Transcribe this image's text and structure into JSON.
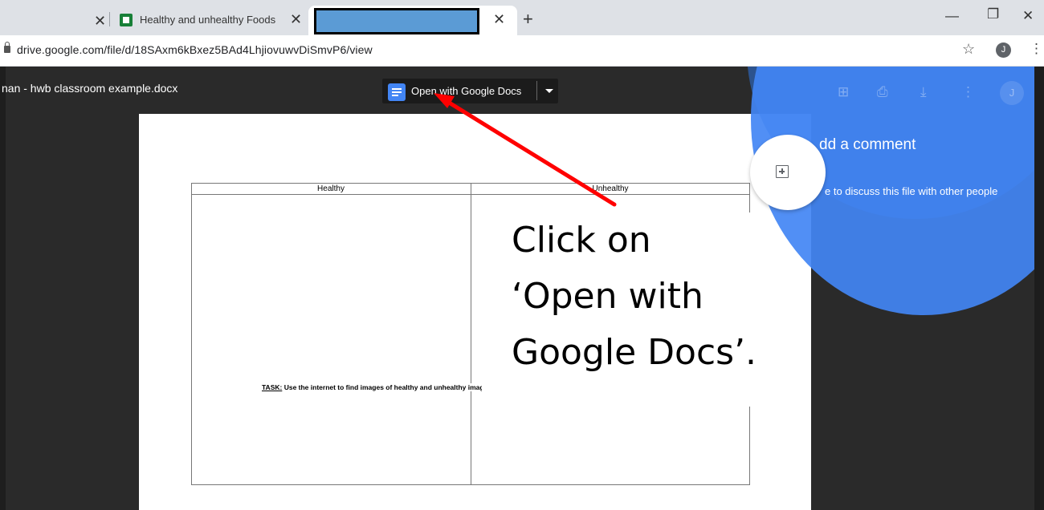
{
  "browser": {
    "tabs": [
      {
        "label": "Healthy and unhealthy Foods"
      }
    ],
    "address": "drive.google.com/file/d/18SAxm6kBxez5BAd4LhjiovuwvDiSmvP6/view",
    "avatar_initial": "J"
  },
  "viewer": {
    "filename": "nan - hwb classroom example.docx",
    "open_button_label": "Open with Google Docs",
    "toolbar_avatar_initial": "J"
  },
  "document": {
    "col_headers": [
      "Healthy",
      "Unhealthy"
    ],
    "task_prefix": "TASK:",
    "task_text": " Use the internet to find images of healthy and unhealthy images of food. Use copy and paste to add the images to the table."
  },
  "comment_panel": {
    "title": "dd a comment",
    "body": "e to discuss this file with other people"
  },
  "annotation": {
    "lines": [
      "Click on",
      "‘Open with",
      "Google Docs’."
    ],
    "arrow_color": "#ff0000"
  },
  "colors": {
    "accent_blue": "#4285f4",
    "viewer_bg": "#2a2a2a",
    "redaction": "#5b9bd5"
  }
}
